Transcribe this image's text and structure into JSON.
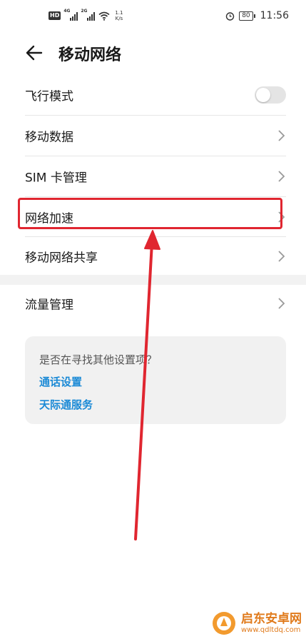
{
  "status_bar": {
    "hd": "HD",
    "sim1_network": "4G",
    "sim2_network": "2G",
    "speed_value": "1.1",
    "speed_unit": "K/s",
    "battery": "80",
    "time": "11:56",
    "icons": [
      "hd-icon",
      "signal-icon",
      "wifi-icon",
      "alarm-icon",
      "battery-icon"
    ]
  },
  "header": {
    "title": "移动网络",
    "back_icon": "arrow-left-icon"
  },
  "settings": {
    "airplane_mode": {
      "label": "飞行模式",
      "enabled": false
    },
    "mobile_data": {
      "label": "移动数据"
    },
    "sim_management": {
      "label": "SIM 卡管理"
    },
    "network_acceleration": {
      "label": "网络加速"
    },
    "mobile_hotspot": {
      "label": "移动网络共享"
    },
    "data_usage": {
      "label": "流量管理"
    }
  },
  "suggestions": {
    "question": "是否在寻找其他设置项？",
    "links": [
      "通话设置",
      "天际通服务"
    ]
  },
  "watermark": {
    "name": "启东安卓网",
    "url": "www.qdltdq.com"
  },
  "colors": {
    "link": "#1b8ad6",
    "annotation": "#e02630",
    "toggle_off": "#e4e4e4"
  }
}
